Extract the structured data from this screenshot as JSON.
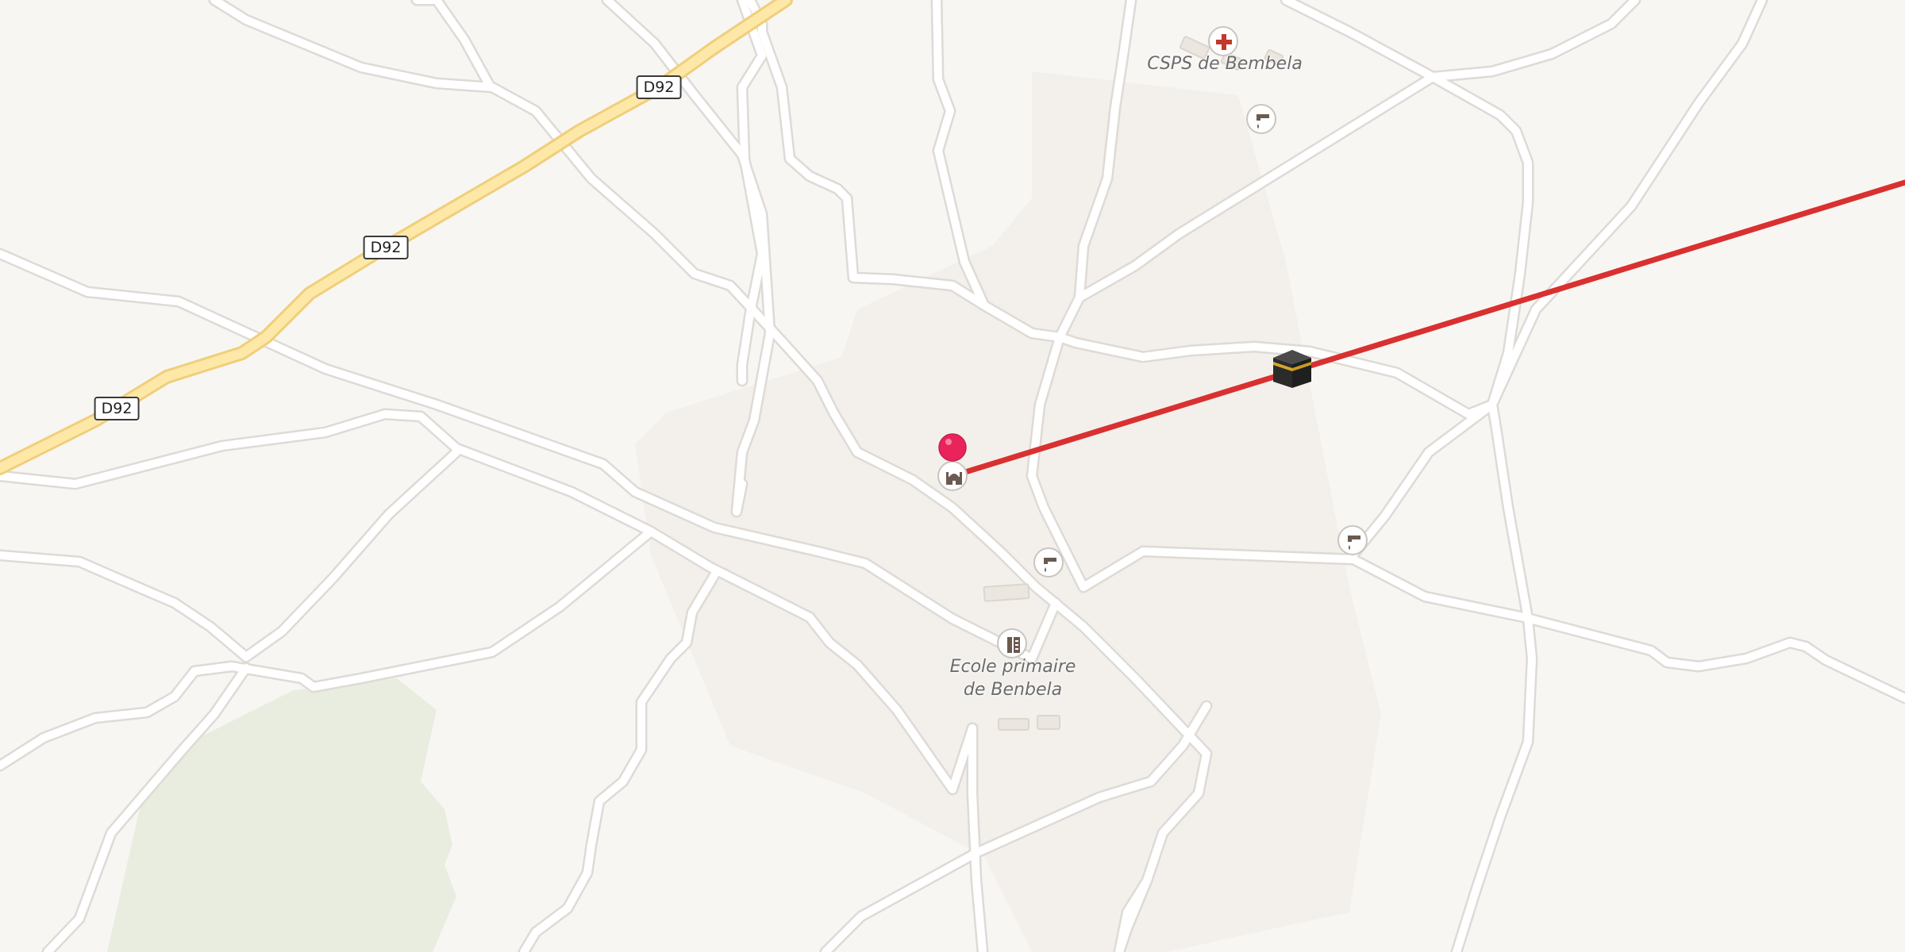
{
  "map": {
    "road_refs": [
      {
        "id": "d92-a",
        "label": "D92"
      },
      {
        "id": "d92-b",
        "label": "D92"
      },
      {
        "id": "d92-c",
        "label": "D92"
      }
    ],
    "places": {
      "health_center": "CSPS de Bembela",
      "school_line1": "Ecole primaire",
      "school_line2": "de Benbela"
    },
    "icons": {
      "health": "first-aid-cross-icon",
      "water": "water-tap-icon",
      "worship": "mosque-icon",
      "school": "school-icon",
      "qibla": "kaaba-icon",
      "pin": "location-pin-icon"
    },
    "colors": {
      "background": "#f8f6f3",
      "minor_road": "#ffffff",
      "road_casing": "#dedad5",
      "primary_road": "#fde8a8",
      "primary_casing": "#f0cf7a",
      "woodland": "#e8ede0",
      "qibla_line": "#d93030",
      "pin": "#e8245a",
      "health_cross": "#c0392b"
    }
  }
}
